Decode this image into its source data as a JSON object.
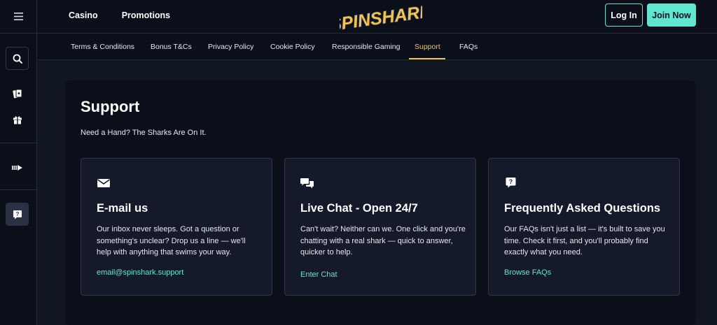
{
  "header": {
    "nav": [
      "Casino",
      "Promotions"
    ],
    "logo_text": "SPINSHARK",
    "login_label": "Log In",
    "join_label": "Join Now"
  },
  "subnav": {
    "items": [
      "Terms & Conditions",
      "Bonus T&Cs",
      "Privacy Policy",
      "Cookie Policy",
      "Responsible Gaming",
      "Support",
      "FAQs"
    ],
    "active": "Support"
  },
  "main": {
    "title": "Support",
    "subtitle": "Need a Hand? The Sharks Are On It.",
    "cards": [
      {
        "icon": "envelope-icon",
        "title": "E-mail us",
        "body": "Our inbox never sleeps. Got a question or something's unclear? Drop us a line — we'll help with anything that swims your way.",
        "link": "email@spinshark.support"
      },
      {
        "icon": "chat-bubbles-icon",
        "title": "Live Chat - Open 24/7",
        "body": "Can't wait? Neither can we. One click and you're chatting with a real shark — quick to answer, quicker to help.",
        "link": "Enter Chat"
      },
      {
        "icon": "question-bubble-icon",
        "title": "Frequently Asked Questions",
        "body": "Our FAQs isn't just a list — it's built to save you time. Check it first, and you'll probably find exactly what you need.",
        "link": "Browse FAQs"
      }
    ]
  },
  "colors": {
    "accent": "#5ee6d3",
    "active_tab": "#f5c344",
    "background": "#111623",
    "panel": "#0b0f19",
    "card": "#141a29"
  }
}
